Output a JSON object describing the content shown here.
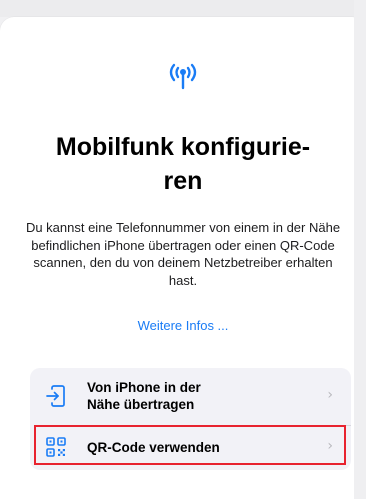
{
  "header": {
    "icon": "cellular-antenna-icon",
    "title": "Mobilfunk konfigurie-\nren",
    "description": "Du kannst eine Telefonnummer von einem in der Nähe befindlichen iPhone übertragen oder einen QR-Code scannen, den du von deinem Netzbetreiber erhalten hast.",
    "link": "Weitere Infos ..."
  },
  "options": [
    {
      "icon": "phone-transfer-icon",
      "label": "Von iPhone in der\nNähe übertragen"
    },
    {
      "icon": "qr-code-icon",
      "label": "QR-Code verwenden"
    }
  ],
  "colors": {
    "accent": "#1a7cf5",
    "highlight": "#e8232f"
  }
}
